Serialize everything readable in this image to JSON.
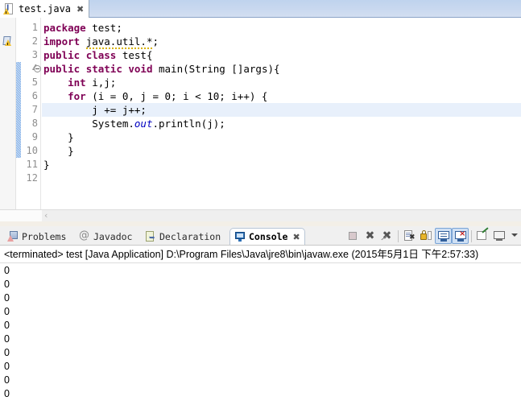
{
  "editor": {
    "tab": {
      "label": "test.java",
      "close": "✖",
      "icon": "java-file-warning-icon"
    },
    "current_line": 7,
    "fold_line": 4,
    "warning_line": 2,
    "range_start_line": 4,
    "range_end_line": 10,
    "line_numbers": [
      "1",
      "2",
      "3",
      "4",
      "5",
      "6",
      "7",
      "8",
      "9",
      "10",
      "11",
      "12"
    ],
    "lines": [
      {
        "n": 1,
        "tokens": [
          {
            "t": "package",
            "c": "kw"
          },
          {
            "t": " test;",
            "c": "pl"
          }
        ]
      },
      {
        "n": 2,
        "tokens": [
          {
            "t": "import",
            "c": "kw"
          },
          {
            "t": " ",
            "c": "pl"
          },
          {
            "t": "java.util.*",
            "c": "squig"
          },
          {
            "t": ";",
            "c": "pl"
          }
        ]
      },
      {
        "n": 3,
        "tokens": [
          {
            "t": "public",
            "c": "kw"
          },
          {
            "t": " ",
            "c": "pl"
          },
          {
            "t": "class",
            "c": "kw"
          },
          {
            "t": " test{",
            "c": "pl"
          }
        ]
      },
      {
        "n": 4,
        "tokens": [
          {
            "t": "public",
            "c": "kw"
          },
          {
            "t": " ",
            "c": "pl"
          },
          {
            "t": "static",
            "c": "kw"
          },
          {
            "t": " ",
            "c": "pl"
          },
          {
            "t": "void",
            "c": "kw"
          },
          {
            "t": " main(String []args){",
            "c": "pl"
          }
        ]
      },
      {
        "n": 5,
        "tokens": [
          {
            "t": "    ",
            "c": "pl"
          },
          {
            "t": "int",
            "c": "kw"
          },
          {
            "t": " i,j;",
            "c": "pl"
          }
        ]
      },
      {
        "n": 6,
        "tokens": [
          {
            "t": "    ",
            "c": "pl"
          },
          {
            "t": "for",
            "c": "kw"
          },
          {
            "t": " (i = 0, j = 0; i < 10; i++) {",
            "c": "pl"
          }
        ]
      },
      {
        "n": 7,
        "tokens": [
          {
            "t": "        j += j++;",
            "c": "pl"
          }
        ]
      },
      {
        "n": 8,
        "tokens": [
          {
            "t": "        System.",
            "c": "pl"
          },
          {
            "t": "out",
            "c": "fld"
          },
          {
            "t": ".println(j);",
            "c": "pl"
          }
        ]
      },
      {
        "n": 9,
        "tokens": [
          {
            "t": "    }",
            "c": "pl"
          }
        ]
      },
      {
        "n": 10,
        "tokens": [
          {
            "t": "    }",
            "c": "pl"
          }
        ]
      },
      {
        "n": 11,
        "tokens": [
          {
            "t": "}",
            "c": "pl"
          }
        ]
      },
      {
        "n": 12,
        "tokens": [
          {
            "t": "",
            "c": "pl"
          }
        ]
      }
    ],
    "hscroll_left_arrow": "‹"
  },
  "bottom_panel": {
    "tabs": [
      {
        "label": "Problems",
        "icon": "problems-icon",
        "active": false
      },
      {
        "label": "Javadoc",
        "icon": "javadoc-icon",
        "active": false
      },
      {
        "label": "Declaration",
        "icon": "declaration-icon",
        "active": false
      },
      {
        "label": "Console",
        "icon": "console-icon",
        "active": true
      }
    ],
    "active_tab_close": "✖",
    "toolbar": [
      {
        "name": "terminate-button",
        "icon": "stop-square-icon"
      },
      {
        "name": "remove-launch-button",
        "icon": "remove-x-icon"
      },
      {
        "name": "remove-all-terminated-button",
        "icon": "remove-all-x-icon"
      },
      {
        "name": "clear-console-button",
        "icon": "clear-console-icon"
      },
      {
        "name": "scroll-lock-button",
        "icon": "scroll-lock-icon"
      },
      {
        "name": "show-console-on-output-button",
        "icon": "console-out-icon",
        "selected": true
      },
      {
        "name": "show-console-on-error-button",
        "icon": "console-err-icon",
        "selected": true
      },
      {
        "name": "pin-console-button",
        "icon": "pin-console-icon"
      },
      {
        "name": "display-selected-console-button",
        "icon": "display-console-icon"
      },
      {
        "name": "console-menu-dropdown",
        "icon": "chevron-down-icon"
      }
    ],
    "console": {
      "status": "<terminated> test [Java Application] D:\\Program Files\\Java\\jre8\\bin\\javaw.exe (2015年5月1日 下午2:57:33)",
      "output": [
        "0",
        "0",
        "0",
        "0",
        "0",
        "0",
        "0",
        "0",
        "0",
        "0"
      ]
    }
  },
  "colors": {
    "keyword": "#7f0055",
    "field": "#0000c0",
    "tabbar_blue": "#c9d8ef",
    "current_line": "#e8f0fb",
    "selected_toolbtn": "#cfe0f4",
    "range_indicator": "#8ab4e8"
  }
}
